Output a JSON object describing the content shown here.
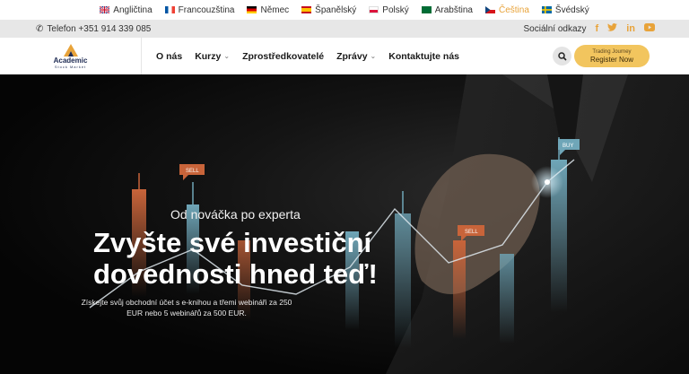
{
  "languages": [
    {
      "label": "Angličtina",
      "flag": "uk-flag-icon"
    },
    {
      "label": "Francouzština",
      "flag": "france-flag-icon"
    },
    {
      "label": "Němec",
      "flag": "germany-flag-icon"
    },
    {
      "label": "Španělský",
      "flag": "spain-flag-icon"
    },
    {
      "label": "Polský",
      "flag": "poland-flag-icon"
    },
    {
      "label": "Arabština",
      "flag": "saudi-flag-icon"
    },
    {
      "label": "Čeština",
      "flag": "czech-flag-icon",
      "active": true
    },
    {
      "label": "Švédský",
      "flag": "sweden-flag-icon"
    }
  ],
  "topbar": {
    "phone": "Telefon +351 914 339 085",
    "social_label": "Sociální odkazy"
  },
  "logo": {
    "name": "Academic",
    "sub": "Stock Market"
  },
  "nav": {
    "items": [
      {
        "label": "O nás",
        "dropdown": false
      },
      {
        "label": "Kurzy",
        "dropdown": true
      },
      {
        "label": "Zprostředkovatelé",
        "dropdown": false
      },
      {
        "label": "Zprávy",
        "dropdown": true
      },
      {
        "label": "Kontaktujte nás",
        "dropdown": false
      }
    ],
    "cta_small": "Trading Journey",
    "cta_big": "Register Now"
  },
  "hero": {
    "kicker": "Od nováčka po experta",
    "headline": "Zvyšte své investiční dovednosti hned teď!",
    "description": "Získejte svůj obchodní účet s e-knihou a třemi webináři za 250 EUR nebo 5 webinářů za 500 EUR.",
    "chart_tags": [
      "SELL",
      "SELL",
      "BUY"
    ]
  },
  "colors": {
    "accent": "#e8a33a",
    "cta": "#f2c55e",
    "brand": "#1d2a52"
  }
}
